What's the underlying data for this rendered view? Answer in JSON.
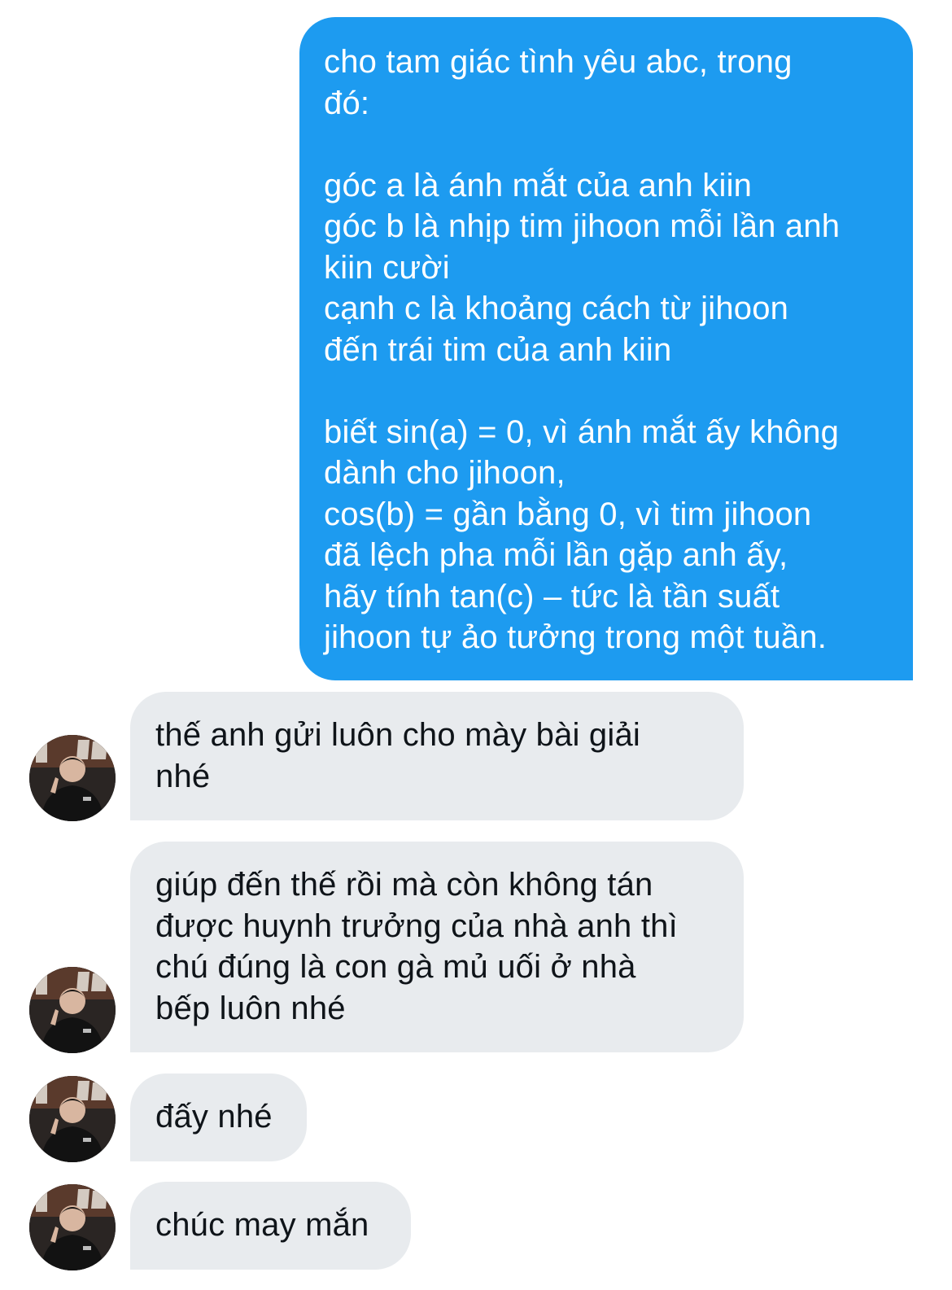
{
  "conversation": {
    "messages": [
      {
        "direction": "outgoing",
        "text": "cho tam giác tình yêu abc, trong\nđó:\n\ngóc a là ánh mắt của anh kiin\ngóc b là nhịp tim jihoon mỗi lần anh\nkiin cười\ncạnh c là khoảng cách từ jihoon\nđến trái tim của anh kiin\n\nbiết sin(a) = 0, vì ánh mắt ấy không\ndành cho jihoon,\ncos(b) = gần bằng 0, vì tim jihoon\nđã lệch pha mỗi lần gặp anh ấy,\nhãy tính tan(c) – tức là tần suất\njihoon tự ảo tưởng trong một tuần."
      },
      {
        "direction": "incoming",
        "text": "thế anh gửi luôn cho mày bài giải\nnhé"
      },
      {
        "direction": "incoming",
        "text": "giúp đến thế rồi mà còn không tán\nđược huynh trưởng của nhà anh thì\nchú đúng là con gà mủ uối ở nhà\nbếp luôn nhé"
      },
      {
        "direction": "incoming",
        "text": "đấy nhé"
      },
      {
        "direction": "incoming",
        "text": "chúc may mắn"
      }
    ]
  },
  "colors": {
    "outgoing_bubble": "#1d9bf0",
    "incoming_bubble": "#e8ebee",
    "background": "#ffffff"
  }
}
